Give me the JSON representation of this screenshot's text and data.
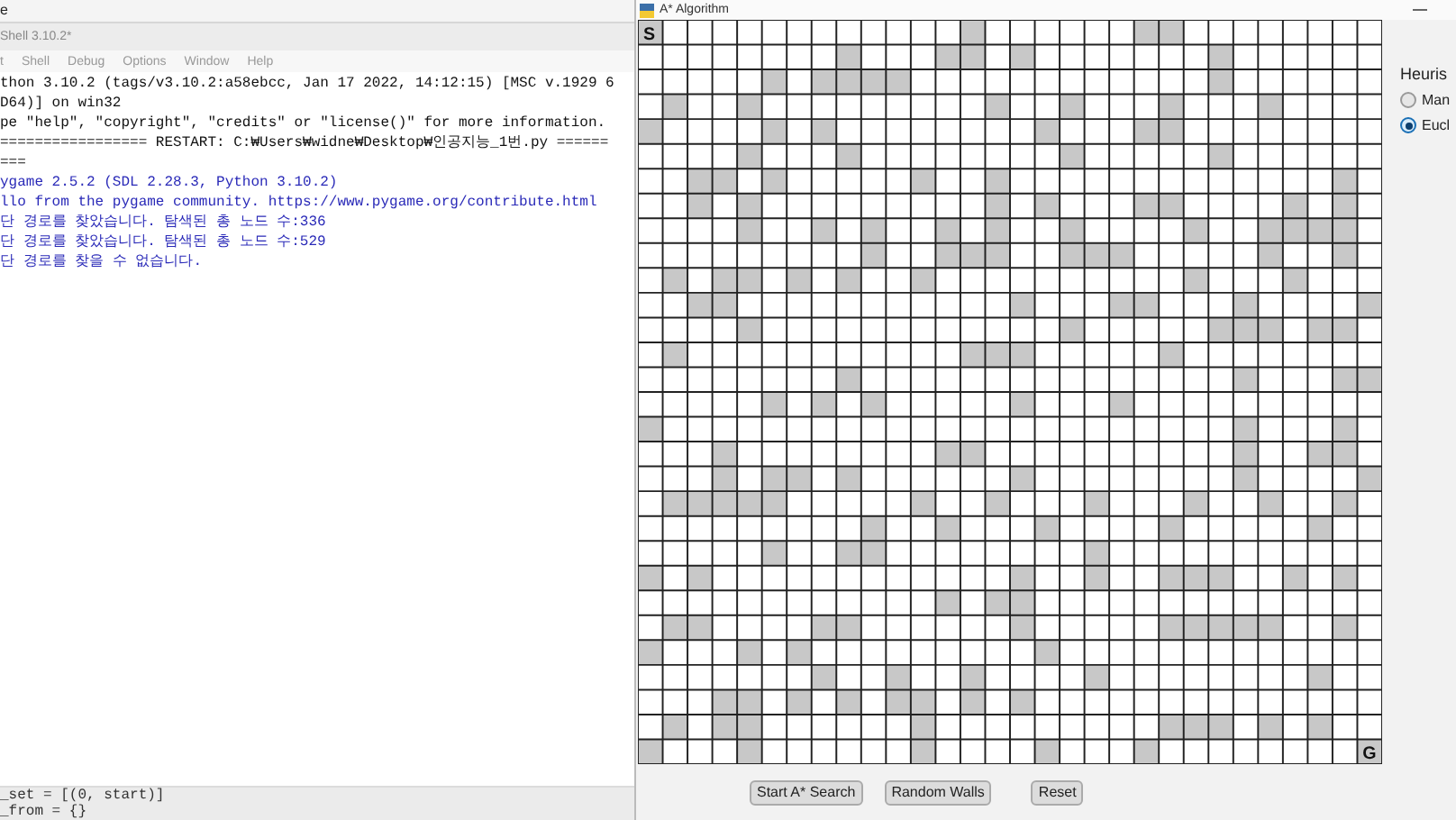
{
  "background_window": {
    "title_fragment": "e"
  },
  "shell_window": {
    "title": "Shell 3.10.2*",
    "menu": [
      "t",
      "Shell",
      "Debug",
      "Options",
      "Window",
      "Help"
    ],
    "lines": [
      {
        "kind": "info",
        "text": "thon 3.10.2 (tags/v3.10.2:a58ebcc, Jan 17 2022, 14:12:15) [MSC v.1929 6"
      },
      {
        "kind": "info",
        "text": "D64)] on win32"
      },
      {
        "kind": "info",
        "text": "pe \"help\", \"copyright\", \"credits\" or \"license()\" for more information."
      },
      {
        "kind": "info",
        "text": "================= RESTART: C:₩Users₩widne₩Desktop₩인공지능_1번.py ======"
      },
      {
        "kind": "info",
        "text": "==="
      },
      {
        "kind": "output",
        "text": "ygame 2.5.2 (SDL 2.28.3, Python 3.10.2)"
      },
      {
        "kind": "output",
        "text": "llo from the pygame community. https://www.pygame.org/contribute.html"
      },
      {
        "kind": "output",
        "text": "단 경로를 찾았습니다. 탐색된 총 노드 수:336"
      },
      {
        "kind": "output",
        "text": "단 경로를 찾았습니다. 탐색된 총 노드 수:529"
      },
      {
        "kind": "output",
        "text": "단 경로를 찾을 수 없습니다."
      }
    ]
  },
  "editor_fragment": {
    "lines": [
      "_set = [(0, start)]",
      "_from = {}"
    ]
  },
  "astar_window": {
    "title": "A* Algorithm",
    "grid": {
      "start_label": "S",
      "goal_label": "G"
    },
    "heuristic": {
      "label": "Heuris",
      "options": [
        {
          "label": "Man",
          "selected": false
        },
        {
          "label": "Eucl",
          "selected": true
        }
      ]
    },
    "buttons": [
      "Start A* Search",
      "Random Walls",
      "Reset"
    ]
  }
}
